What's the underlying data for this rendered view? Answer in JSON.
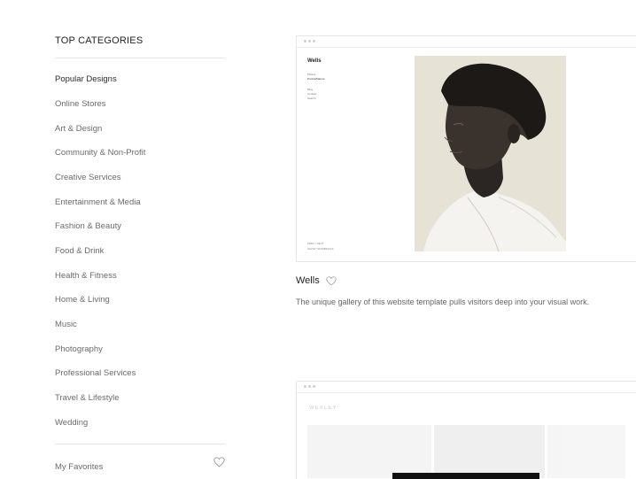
{
  "sidebar": {
    "title": "TOP CATEGORIES",
    "categories": [
      "Popular Designs",
      "Online Stores",
      "Art & Design",
      "Community & Non-Profit",
      "Creative Services",
      "Entertainment & Media",
      "Fashion & Beauty",
      "Food & Drink",
      "Health & Fitness",
      "Home & Living",
      "Music",
      "Photography",
      "Professional Services",
      "Travel & Lifestyle",
      "Wedding"
    ],
    "favorites_label": "My Favorites"
  },
  "cards": [
    {
      "title": "Wells",
      "description": "The unique gallery of this website template pulls visitors deep into your visual work.",
      "preview": {
        "logo": "Wells",
        "nav": [
          "Photos",
          "Portrait/Nature",
          "Blog",
          "Contact",
          "Search"
        ],
        "footer": [
          "PREV / NEXT",
          "SHOW THUMBNAILS"
        ]
      }
    },
    {
      "preview": {
        "logo": "WEXLEY"
      }
    }
  ],
  "colors": {
    "accent_text": "#222222",
    "muted_text": "#6b6b6b",
    "divider": "#e6e6e6"
  },
  "icons": {
    "favorite": "heart-outline-icon",
    "window_dots": "browser-dots-icon"
  }
}
